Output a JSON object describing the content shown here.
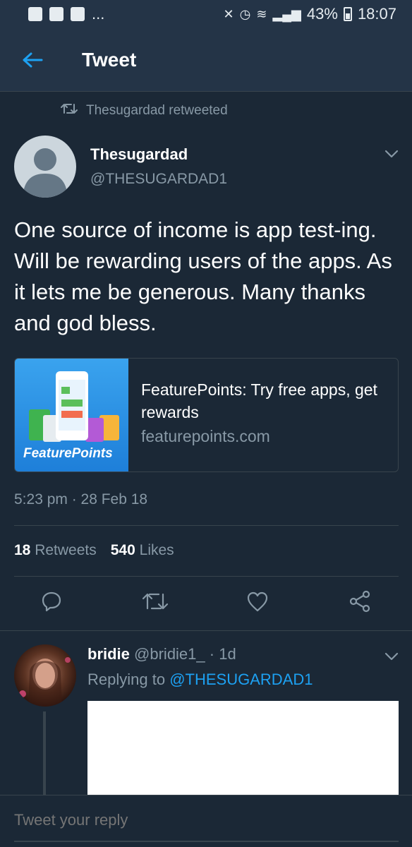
{
  "status_bar": {
    "left_icons": [
      "facebook-icon",
      "youtube-icon",
      "message-icon"
    ],
    "more": "...",
    "battery": "43%",
    "time": "18:07"
  },
  "header": {
    "title": "Tweet",
    "back_icon": "arrow-left-icon"
  },
  "retweet": {
    "text": "Thesugardad retweeted",
    "icon": "retweet-icon"
  },
  "tweet": {
    "author_name": "Thesugardad",
    "author_handle": "@THESUGARDAD1",
    "text": "One source of income is app test-ing. Will be rewarding users of the apps. As it lets me be generous. Many thanks and god bless.",
    "timestamp": "5:23 pm · 28 Feb 18",
    "retweets_count": "18",
    "retweets_label": "Retweets",
    "likes_count": "540",
    "likes_label": "Likes"
  },
  "card": {
    "image_label": "FeaturePoints",
    "title": "FeaturePoints: Try free apps, get rewards",
    "domain": "featurepoints.com"
  },
  "actions": [
    "reply-icon",
    "retweet-icon",
    "like-icon",
    "share-icon"
  ],
  "reply": {
    "name": "bridie",
    "handle": "@bridie1_",
    "separator": "·",
    "age": "1d",
    "replying_prefix": "Replying to",
    "replying_to": "@THESUGARDAD1"
  },
  "compose": {
    "placeholder": "Tweet your reply"
  },
  "colors": {
    "background": "#1b2836",
    "header": "#243447",
    "accent": "#1da1f2",
    "secondary_text": "#8899a6",
    "divider": "#38444d"
  }
}
